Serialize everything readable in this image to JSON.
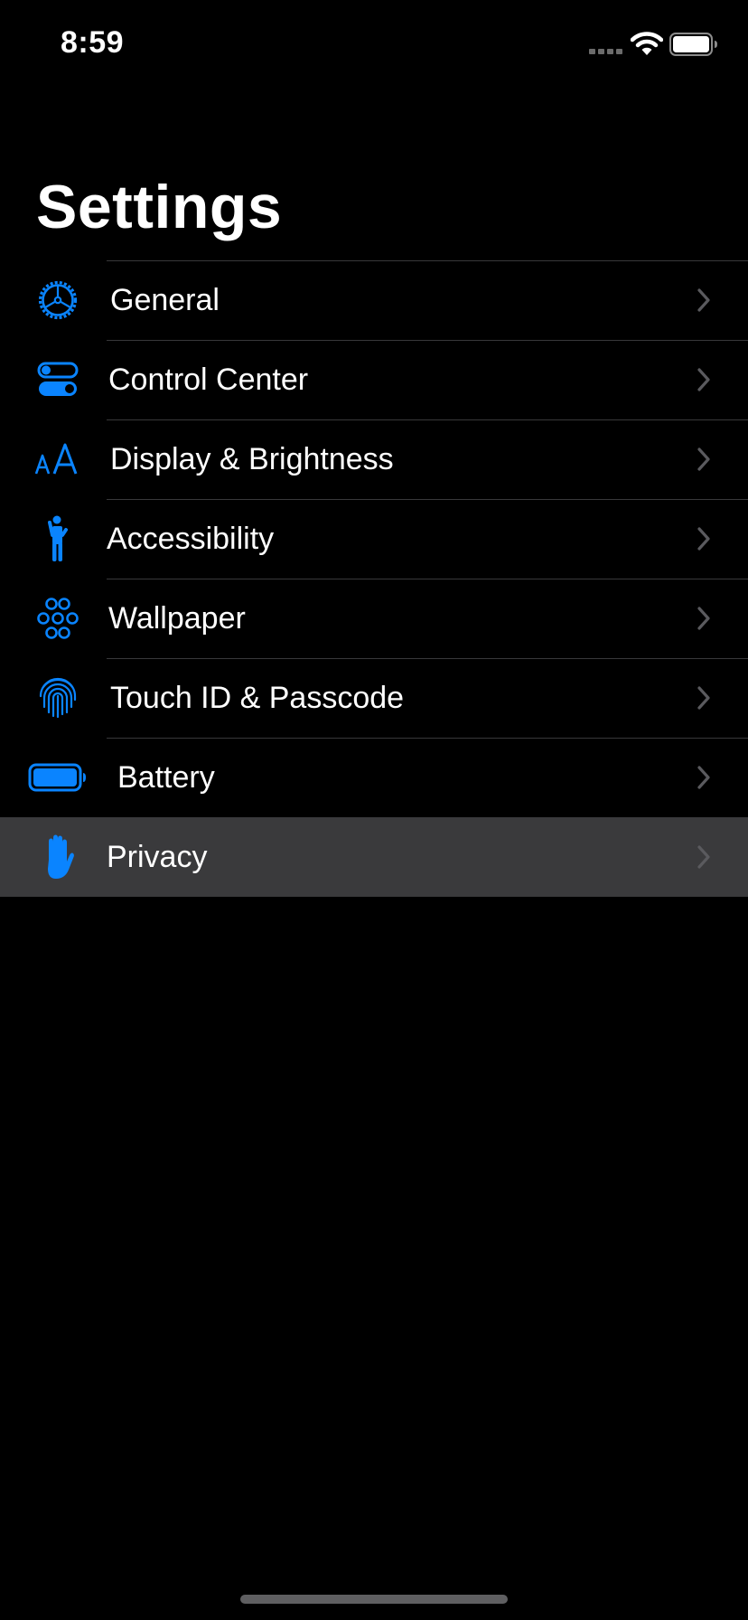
{
  "status_bar": {
    "time": "8:59",
    "icons": [
      "cellular-signal-icon",
      "wifi-icon",
      "battery-icon"
    ]
  },
  "header": {
    "title": "Settings"
  },
  "settings": {
    "items": [
      {
        "label": "General",
        "icon": "gear-icon",
        "highlighted": false
      },
      {
        "label": "Control Center",
        "icon": "toggle-switches-icon",
        "highlighted": false
      },
      {
        "label": "Display & Brightness",
        "icon": "text-size-icon",
        "highlighted": false
      },
      {
        "label": "Accessibility",
        "icon": "accessibility-figure-icon",
        "highlighted": false
      },
      {
        "label": "Wallpaper",
        "icon": "flower-icon",
        "highlighted": false
      },
      {
        "label": "Touch ID & Passcode",
        "icon": "fingerprint-icon",
        "highlighted": false
      },
      {
        "label": "Battery",
        "icon": "battery-icon",
        "highlighted": false
      },
      {
        "label": "Privacy",
        "icon": "hand-icon",
        "highlighted": true
      }
    ]
  },
  "colors": {
    "background": "#000000",
    "accent": "#0a84ff",
    "text": "#ffffff",
    "separator": "#38383a",
    "row_highlight": "#3a3a3c",
    "chevron": "#5a5a5e"
  }
}
